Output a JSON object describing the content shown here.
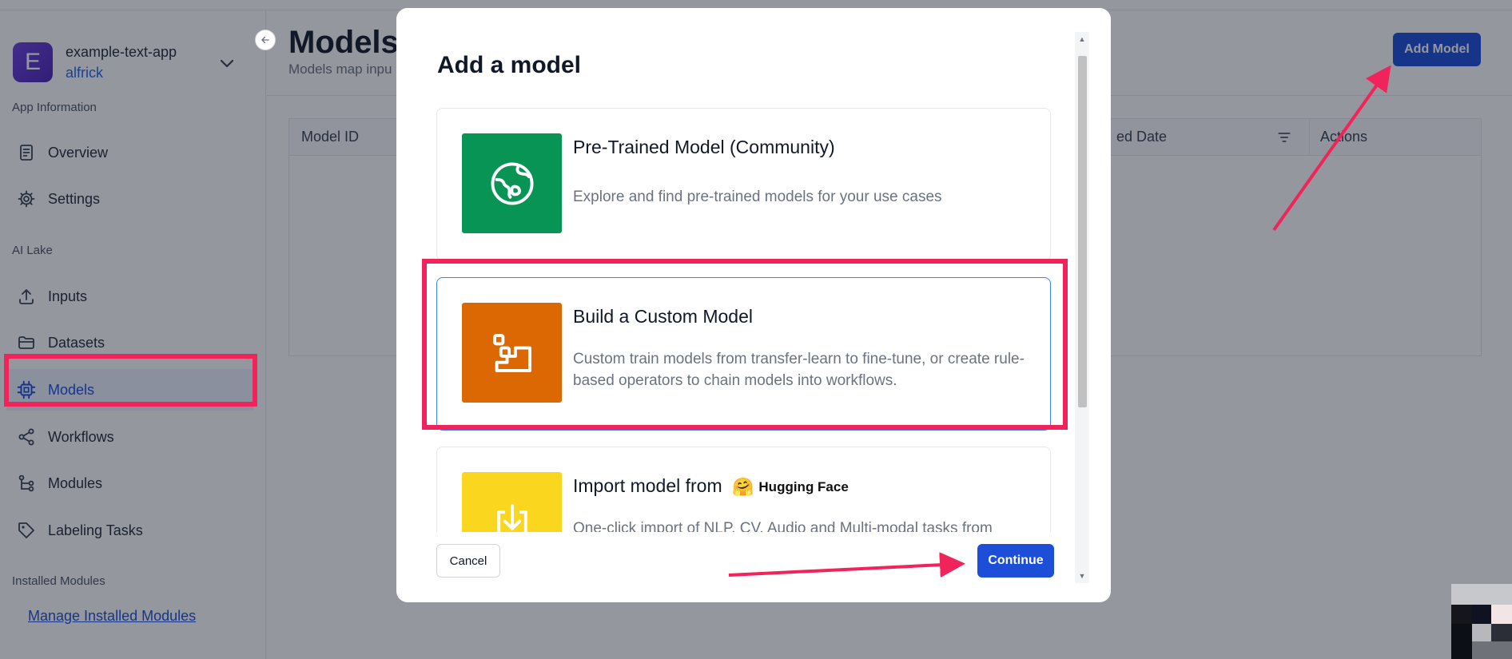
{
  "sidebar": {
    "app_initial": "E",
    "app_name": "example-text-app",
    "app_user": "alfrick",
    "sections": {
      "app_information": "App Information",
      "ai_lake": "AI Lake",
      "installed_modules": "Installed Modules"
    },
    "items": [
      {
        "label": "Overview",
        "icon": "document-icon"
      },
      {
        "label": "Settings",
        "icon": "gear-icon"
      },
      {
        "label": "Inputs",
        "icon": "upload-icon"
      },
      {
        "label": "Datasets",
        "icon": "folder-icon"
      },
      {
        "label": "Models",
        "icon": "chip-icon",
        "active": true
      },
      {
        "label": "Workflows",
        "icon": "share-icon"
      },
      {
        "label": "Modules",
        "icon": "tree-icon"
      },
      {
        "label": "Labeling Tasks",
        "icon": "tag-icon"
      }
    ],
    "manage_link": "Manage Installed Modules"
  },
  "page": {
    "title": "Models",
    "subtitle": "Models map inpu",
    "add_model_label": "Add Model"
  },
  "table": {
    "columns": [
      "Model ID",
      "ed Date",
      "Actions"
    ]
  },
  "modal": {
    "title": "Add a model",
    "options": [
      {
        "title": "Pre-Trained Model (Community)",
        "description": "Explore and find pre-trained models for your use cases",
        "icon": "globe-icon",
        "color": "#079455"
      },
      {
        "title": "Build a Custom Model",
        "description": "Custom train models from transfer-learn to fine-tune, or create rule-based operators to chain models into workflows.",
        "icon": "steps-icon",
        "color": "#dc6803",
        "selected": true
      },
      {
        "title": "Import model from",
        "brand": "Hugging Face",
        "brand_emoji": "🤗",
        "description": "One-click import of NLP, CV, Audio and Multi-modal tasks from",
        "icon": "import-icon",
        "color": "#fad61e"
      }
    ],
    "cancel_label": "Cancel",
    "continue_label": "Continue"
  },
  "colors": {
    "primary": "#1d4ed8",
    "highlight": "#f0245a"
  }
}
